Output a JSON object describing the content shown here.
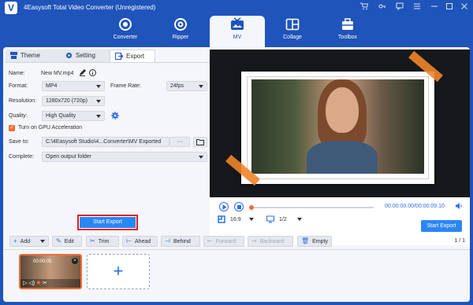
{
  "app": {
    "title": "4Easysoft Total Video Converter (Unregistered)",
    "logo_letter": "V"
  },
  "nav": [
    {
      "label": "Converter",
      "icon": "converter-icon"
    },
    {
      "label": "Ripper",
      "icon": "ripper-icon"
    },
    {
      "label": "MV",
      "icon": "mv-icon",
      "active": true
    },
    {
      "label": "Collage",
      "icon": "collage-icon"
    },
    {
      "label": "Toolbox",
      "icon": "toolbox-icon"
    }
  ],
  "tabs": {
    "theme": "Theme",
    "setting": "Setting",
    "export": "Export"
  },
  "export": {
    "name_label": "Name:",
    "name_value": "New MV.mp4",
    "format_label": "Format:",
    "format_value": "MP4",
    "framerate_label": "Frame Rate:",
    "framerate_value": "24fps",
    "resolution_label": "Resolution:",
    "resolution_value": "1280x720 (720p)",
    "quality_label": "Quality:",
    "quality_value": "High Quality",
    "gpu_label": "Turn on GPU Acceleration",
    "saveto_label": "Save to:",
    "saveto_value": "C:\\4Easysoft Studio\\4...Converter\\MV Exported",
    "saveto_browse": "···",
    "complete_label": "Complete:",
    "complete_value": "Open output folder",
    "start_export": "Start Export"
  },
  "player": {
    "time": "00:00:00.00/00:00:09.10",
    "ratio": "16:9",
    "page": "1/2",
    "export_button": "Start Export"
  },
  "toolbar": {
    "add": "Add",
    "edit": "Edit",
    "trim": "Trim",
    "ahead": "Ahead",
    "behind": "Behind",
    "forward": "Forward",
    "backward": "Backward",
    "empty": "Empty",
    "page": "1 / 1"
  },
  "clip": {
    "duration": "00:00:05"
  },
  "colors": {
    "brand": "#1f54ba",
    "accent": "#2b86f5",
    "orange": "#f36c35",
    "highlight": "#e02020"
  }
}
